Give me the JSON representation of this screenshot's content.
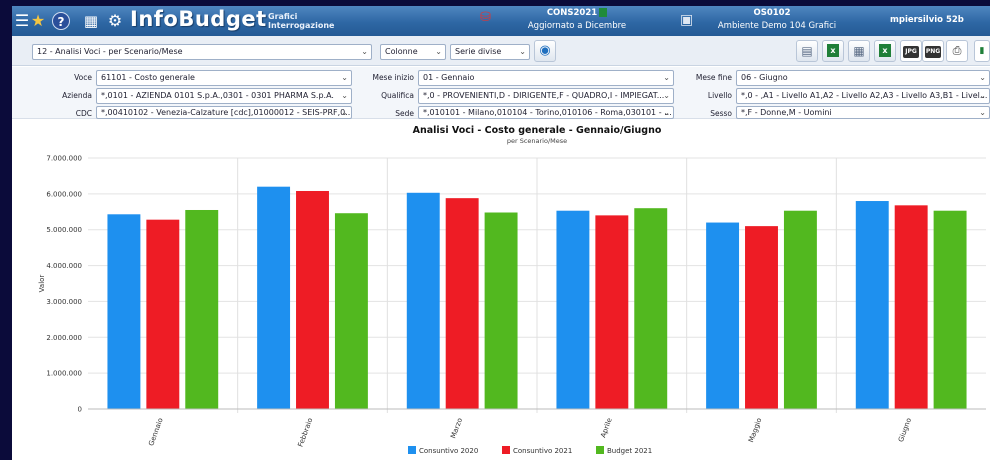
{
  "header": {
    "brand": "InfoBudget",
    "brand_sub_1": "Grafici",
    "brand_sub_2": "Interrogazione",
    "cons_title": "CONS2021",
    "cons_sub": "Aggiornato a Dicembre",
    "env_title": "OS0102",
    "env_sub": "Ambiente Demo 104 Grafici",
    "user": "mpiersilvio 52b"
  },
  "toolbar": {
    "report_select": "12 - Analisi Voci - per Scenario/Mese",
    "columns_select": "Colonne",
    "series_select": "Serie divise"
  },
  "filters": {
    "voce_label": "Voce",
    "voce_value": "61101 - Costo generale",
    "azienda_label": "Azienda",
    "azienda_value": "*,0101 - AZIENDA 0101 S.p.A.,0301 - 0301 PHARMA S.p.A.",
    "cdc_label": "CDC",
    "cdc_value": "*,00410102 - Venezia-Calzature [cdc],01000012 - SEIS-PRF,0...",
    "mese_inizio_label": "Mese inizio",
    "mese_inizio_value": "01 - Gennaio",
    "qualifica_label": "Qualifica",
    "qualifica_value": "*,0 - PROVENIENTI,D - DIRIGENTE,F - QUADRO,I - IMPIEGAT...",
    "sede_label": "Sede",
    "sede_value": "*,010101 - Milano,010104 - Torino,010106 - Roma,030101 - ...",
    "mese_fine_label": "Mese fine",
    "mese_fine_value": "06 - Giugno",
    "livello_label": "Livello",
    "livello_value": "*,0 - ,A1 - Livello A1,A2 - Livello A2,A3 - Livello A3,B1 - Livel...",
    "sesso_label": "Sesso",
    "sesso_value": "*,F - Donne,M - Uomini"
  },
  "colors": {
    "consuntivo_2020": "#1e90ef",
    "consuntivo_2021": "#ee1c25",
    "budget_2021": "#52b81f"
  },
  "chart_data": {
    "type": "bar",
    "title": "Analisi Voci - Costo generale - Gennaio/Giugno",
    "subtitle": "per Scenario/Mese",
    "ylabel": "Valor",
    "ylim": [
      0,
      7000000
    ],
    "yticks": [
      "0",
      "1.000.000",
      "2.000.000",
      "3.000.000",
      "4.000.000",
      "5.000.000",
      "6.000.000",
      "7.000.000"
    ],
    "categories": [
      "Gennaio",
      "Febbraio",
      "Marzo",
      "Aprile",
      "Maggio",
      "Giugno"
    ],
    "series": [
      {
        "name": "Consuntivo 2020",
        "values": [
          5430000,
          6200000,
          6030000,
          5530000,
          5200000,
          5800000
        ]
      },
      {
        "name": "Consuntivo 2021",
        "values": [
          5280000,
          6080000,
          5880000,
          5400000,
          5100000,
          5680000
        ]
      },
      {
        "name": "Budget 2021",
        "values": [
          5550000,
          5460000,
          5480000,
          5600000,
          5530000,
          5530000
        ]
      }
    ],
    "legend_position": "bottom-center",
    "grid": true
  }
}
